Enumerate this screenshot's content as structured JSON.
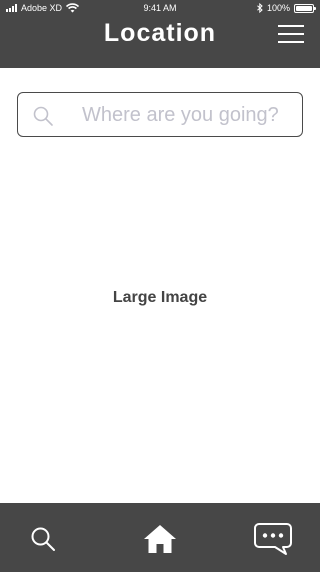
{
  "status_bar": {
    "carrier": "Adobe XD",
    "time": "9:41 AM",
    "battery": "100%",
    "battery_level": 1.0,
    "icons": [
      "signal-icon",
      "wifi-icon",
      "bluetooth-icon",
      "battery-icon"
    ]
  },
  "header": {
    "title": "Location",
    "menu_icon": "hamburger-menu-icon"
  },
  "search": {
    "placeholder": "Where are you going?",
    "value": "",
    "icon": "search-icon"
  },
  "main": {
    "image_label": "Large Image"
  },
  "tabbar": {
    "tabs": [
      {
        "icon": "search-icon"
      },
      {
        "icon": "home-icon"
      },
      {
        "icon": "chat-icon"
      }
    ]
  },
  "colors": {
    "bar_background": "#474747",
    "bar_foreground": "#ffffff",
    "placeholder": "#c2c2cc",
    "input_border": "#4a4a4a"
  }
}
